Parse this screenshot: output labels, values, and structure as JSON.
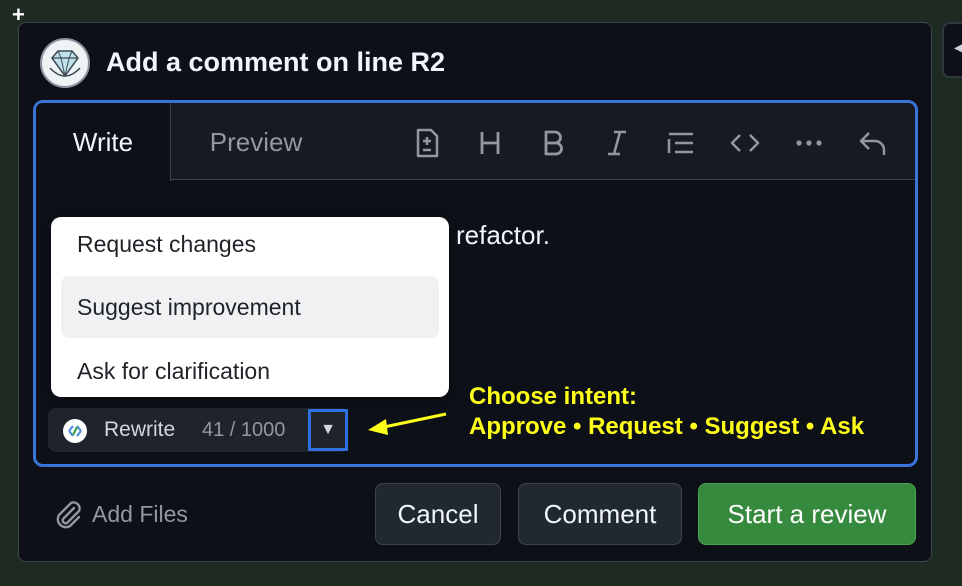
{
  "dialog": {
    "title": "Add a comment on line R2"
  },
  "editor": {
    "tabs": [
      {
        "label": "Write",
        "active": true
      },
      {
        "label": "Preview",
        "active": false
      }
    ],
    "toolbar_icons": [
      "file-diff-icon",
      "heading-icon",
      "bold-icon",
      "italic-icon",
      "list-icon",
      "code-icon",
      "more-icon",
      "reply-icon"
    ],
    "body_text": "refactor.",
    "intent_menu": {
      "items": [
        {
          "label": "Request changes",
          "highlighted": false
        },
        {
          "label": "Suggest improvement",
          "highlighted": true
        },
        {
          "label": "Ask for clarification",
          "highlighted": false
        }
      ]
    },
    "rewrite": {
      "label": "Rewrite",
      "counter": "41 / 1000",
      "toggle_glyph": "▼"
    }
  },
  "annotation": {
    "line1": "Choose intent:",
    "line2": "Approve • Request • Suggest • Ask",
    "color": "#ffff1a"
  },
  "footer": {
    "add_files_label": "Add Files",
    "cancel_label": "Cancel",
    "comment_label": "Comment",
    "start_review_label": "Start a review"
  },
  "colors": {
    "focus_border": "#3b74d8",
    "primary_button": "#368a3e",
    "background": "#0d1117"
  }
}
